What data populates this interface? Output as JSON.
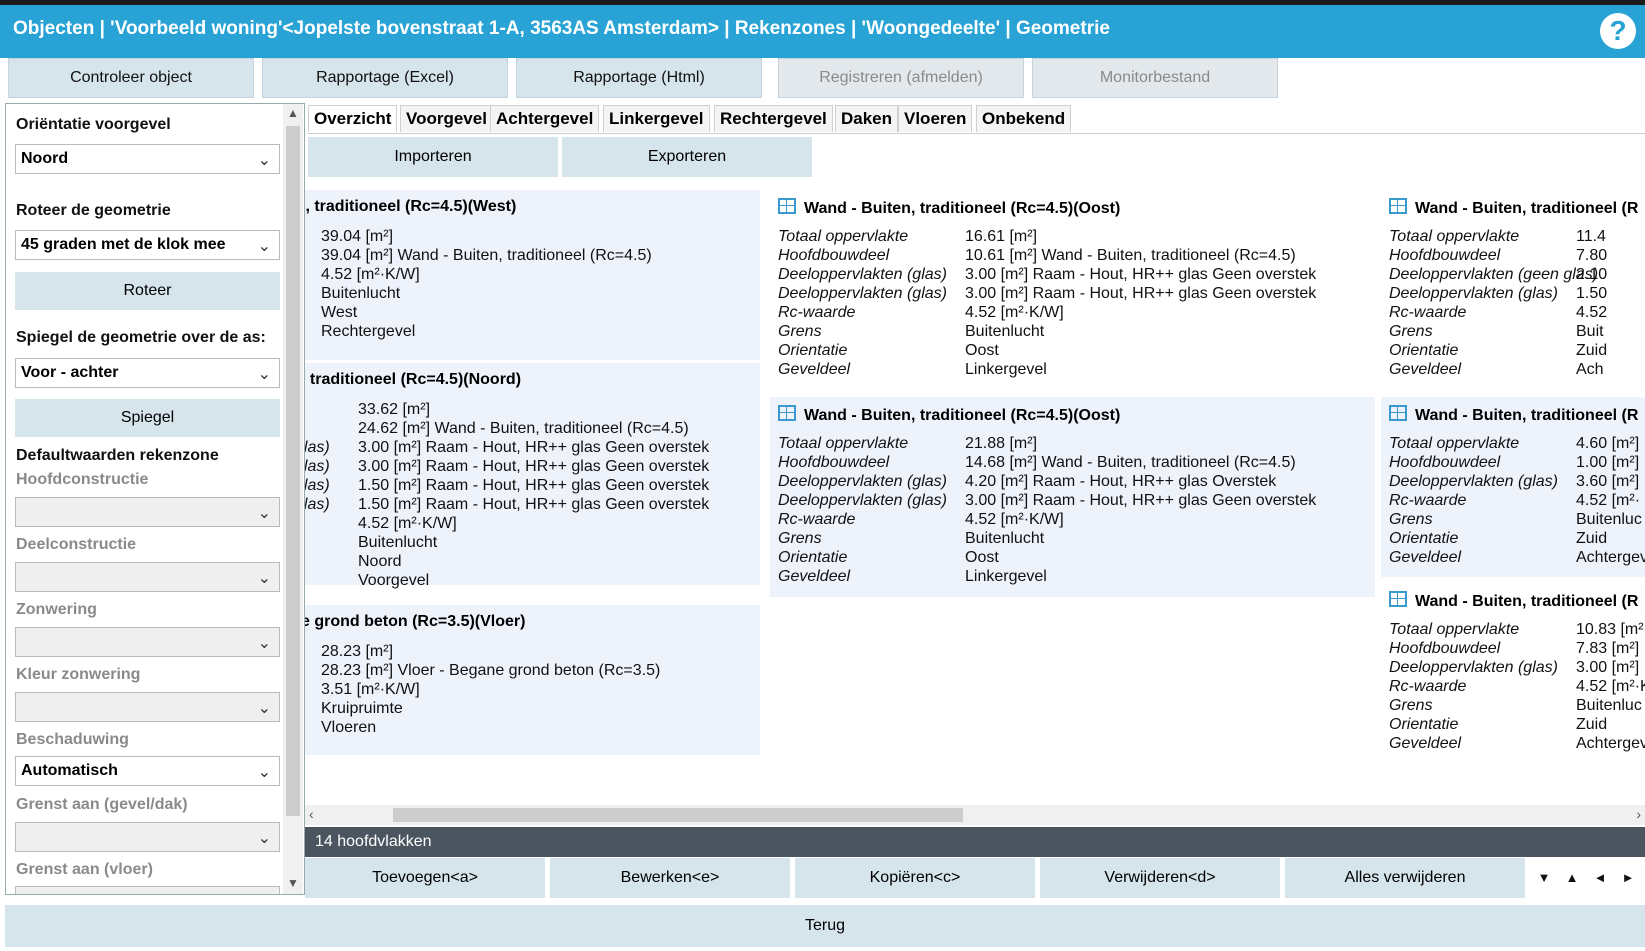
{
  "title": "Objecten | 'Voorbeeld woning'<Jopelste bovenstraat 1-A, 3563AS Amsterdam> | Rekenzones | 'Woongedeelte' | Geometrie",
  "help": "?",
  "topbar": [
    "Controleer object",
    "Rapportage (Excel)",
    "Rapportage (Html)",
    "Registreren (afmelden)",
    "Monitorbestand"
  ],
  "left": {
    "orientation_label": "Oriëntatie voorgevel",
    "orientation_value": "Noord",
    "rotate_label": "Roteer de geometrie",
    "rotate_value": "45 graden met de klok mee",
    "rotate_button": "Roteer",
    "mirror_label": "Spiegel de geometrie over de as:",
    "mirror_value": "Voor - achter",
    "mirror_button": "Spiegel",
    "defaults_label": "Defaultwaarden rekenzone",
    "hoofdconstructie": "Hoofdconstructie",
    "deelconstructie": "Deelconstructie",
    "zonwering": "Zonwering",
    "kleur_zonwering": "Kleur zonwering",
    "beschaduwing": "Beschaduwing",
    "beschaduwing_value": "Automatisch",
    "grenst_gevel": "Grenst aan (gevel/dak)",
    "grenst_vloer": "Grenst aan (vloer)"
  },
  "tabs": [
    "Overzicht",
    "Voorgevel",
    "Achtergevel",
    "Linkergevel",
    "Rechtergevel",
    "Daken",
    "Vloeren",
    "Onbekend"
  ],
  "actions": {
    "import": "Importeren",
    "export": "Exporteren"
  },
  "cards": [
    {
      "title": "i, traditioneel (Rc=4.5)(West)",
      "icon": false,
      "rows": [
        {
          "k": "",
          "v": "39.04 [m²]"
        },
        {
          "k": "",
          "v": "39.04 [m²] Wand - Buiten, traditioneel (Rc=4.5)"
        },
        {
          "k": "",
          "v": "4.52 [m²·K/W]"
        },
        {
          "k": "",
          "v": "Buitenlucht"
        },
        {
          "k": "",
          "v": "West"
        },
        {
          "k": "",
          "v": "Rechtergevel"
        }
      ]
    },
    {
      "title": ", traditioneel (Rc=4.5)(Noord)",
      "icon": false,
      "rows": [
        {
          "k": "",
          "v": "33.62 [m²]"
        },
        {
          "k": "",
          "v": "24.62 [m²] Wand - Buiten, traditioneel (Rc=4.5)"
        },
        {
          "k": "glas)",
          "v": "3.00 [m²] Raam - Hout, HR++ glas Geen overstek"
        },
        {
          "k": "glas)",
          "v": "3.00 [m²] Raam - Hout, HR++ glas Geen overstek"
        },
        {
          "k": "glas)",
          "v": "1.50 [m²] Raam - Hout, HR++ glas Geen overstek"
        },
        {
          "k": "glas)",
          "v": "1.50 [m²] Raam - Hout, HR++ glas Geen overstek"
        },
        {
          "k": "",
          "v": "4.52 [m²·K/W]"
        },
        {
          "k": "",
          "v": "Buitenlucht"
        },
        {
          "k": "",
          "v": "Noord"
        },
        {
          "k": "",
          "v": "Voorgevel"
        }
      ]
    },
    {
      "title": "e grond beton (Rc=3.5)(Vloer)",
      "icon": false,
      "rows": [
        {
          "k": "",
          "v": "28.23 [m²]"
        },
        {
          "k": "",
          "v": "28.23 [m²] Vloer - Begane grond beton (Rc=3.5)"
        },
        {
          "k": "",
          "v": "3.51 [m²·K/W]"
        },
        {
          "k": "",
          "v": "Kruipruimte"
        },
        {
          "k": "",
          "v": "Vloeren"
        }
      ]
    },
    {
      "title": "Wand - Buiten, traditioneel (Rc=4.5)(Oost)",
      "icon": true,
      "rows": [
        {
          "k": "Totaal oppervlakte",
          "v": "16.61 [m²]"
        },
        {
          "k": "Hoofdbouwdeel",
          "v": "10.61 [m²] Wand - Buiten, traditioneel (Rc=4.5)"
        },
        {
          "k": "Deeloppervlakten (glas)",
          "v": "3.00 [m²] Raam - Hout, HR++ glas Geen overstek"
        },
        {
          "k": "Deeloppervlakten (glas)",
          "v": "3.00 [m²] Raam - Hout, HR++ glas Geen overstek"
        },
        {
          "k": "Rc-waarde",
          "v": "4.52 [m²·K/W]"
        },
        {
          "k": "Grens",
          "v": "Buitenlucht"
        },
        {
          "k": "Orientatie",
          "v": "Oost"
        },
        {
          "k": "Geveldeel",
          "v": "Linkergevel"
        }
      ]
    },
    {
      "title": "Wand - Buiten, traditioneel (Rc=4.5)(Oost)",
      "icon": true,
      "rows": [
        {
          "k": "Totaal oppervlakte",
          "v": "21.88 [m²]"
        },
        {
          "k": "Hoofdbouwdeel",
          "v": "14.68 [m²] Wand - Buiten, traditioneel (Rc=4.5)"
        },
        {
          "k": "Deeloppervlakten (glas)",
          "v": "4.20 [m²] Raam - Hout, HR++ glas Overstek"
        },
        {
          "k": "Deeloppervlakten (glas)",
          "v": "3.00 [m²] Raam - Hout, HR++ glas Geen overstek"
        },
        {
          "k": "Rc-waarde",
          "v": "4.52 [m²·K/W]"
        },
        {
          "k": "Grens",
          "v": "Buitenlucht"
        },
        {
          "k": "Orientatie",
          "v": "Oost"
        },
        {
          "k": "Geveldeel",
          "v": "Linkergevel"
        }
      ]
    },
    {
      "title": "Wand - Buiten, traditioneel (R",
      "icon": true,
      "rows": [
        {
          "k": "Totaal oppervlakte",
          "v": "11.4"
        },
        {
          "k": "Hoofdbouwdeel",
          "v": "7.80"
        },
        {
          "k": "Deeloppervlakten (geen glas)",
          "v": "2.10"
        },
        {
          "k": "Deeloppervlakten (glas)",
          "v": "1.50"
        },
        {
          "k": "Rc-waarde",
          "v": "4.52"
        },
        {
          "k": "Grens",
          "v": "Buit"
        },
        {
          "k": "Orientatie",
          "v": "Zuid"
        },
        {
          "k": "Geveldeel",
          "v": "Ach"
        }
      ]
    },
    {
      "title": "Wand - Buiten, traditioneel (R",
      "icon": true,
      "rows": [
        {
          "k": "Totaal oppervlakte",
          "v": "4.60 [m²]"
        },
        {
          "k": "Hoofdbouwdeel",
          "v": "1.00 [m²]"
        },
        {
          "k": "Deeloppervlakten (glas)",
          "v": "3.60 [m²]"
        },
        {
          "k": "Rc-waarde",
          "v": "4.52 [m²·"
        },
        {
          "k": "Grens",
          "v": "Buitenluc"
        },
        {
          "k": "Orientatie",
          "v": "Zuid"
        },
        {
          "k": "Geveldeel",
          "v": "Achtergev"
        }
      ]
    },
    {
      "title": "Wand - Buiten, traditioneel (R",
      "icon": true,
      "rows": [
        {
          "k": "Totaal oppervlakte",
          "v": "10.83 [m²"
        },
        {
          "k": "Hoofdbouwdeel",
          "v": "7.83 [m²]"
        },
        {
          "k": "Deeloppervlakten (glas)",
          "v": "3.00 [m²]"
        },
        {
          "k": "Rc-waarde",
          "v": "4.52 [m²·K"
        },
        {
          "k": "Grens",
          "v": "Buitenluc"
        },
        {
          "k": "Orientatie",
          "v": "Zuid"
        },
        {
          "k": "Geveldeel",
          "v": "Achtergev"
        }
      ]
    }
  ],
  "status": "14 hoofdvlakken",
  "bottom": [
    "Toevoegen<a>",
    "Bewerken<e>",
    "Kopiëren<c>",
    "Verwijderen<d>",
    "Alles verwijderen"
  ],
  "nav": [
    "▼",
    "▲",
    "◄",
    "►"
  ],
  "terug": "Terug"
}
